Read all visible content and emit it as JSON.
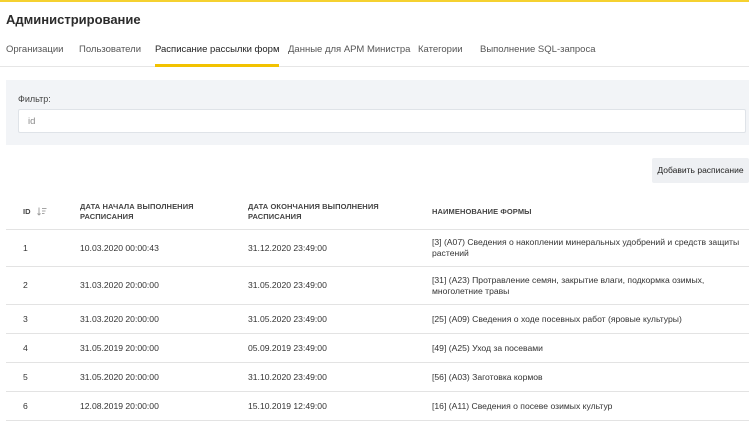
{
  "app": {
    "title": "Администрирование"
  },
  "tabs": [
    {
      "label": "Организации",
      "active": false
    },
    {
      "label": "Пользователи",
      "active": false
    },
    {
      "label": "Расписание рассылки форм",
      "active": true
    },
    {
      "label": "Данные для АРМ Министра",
      "active": false
    },
    {
      "label": "Категории",
      "active": false
    },
    {
      "label": "Выполнение SQL-запроса",
      "active": false
    }
  ],
  "filter": {
    "label": "Фильтр:",
    "placeholder": "id",
    "value": ""
  },
  "toolbar": {
    "add_label": "Добавить расписание"
  },
  "table": {
    "columns": [
      {
        "key": "id",
        "label": "ID",
        "sort_icon": "sort-icon"
      },
      {
        "key": "start",
        "label": "ДАТА НАЧАЛА ВЫПОЛНЕНИЯ РАСПИСАНИЯ"
      },
      {
        "key": "end",
        "label": "ДАТА ОКОНЧАНИЯ ВЫПОЛНЕНИЯ РАСПИСАНИЯ"
      },
      {
        "key": "name",
        "label": "НАИМЕНОВАНИЕ ФОРМЫ"
      }
    ],
    "rows": [
      {
        "id": "1",
        "start": "10.03.2020 00:00:43",
        "end": "31.12.2020 23:49:00",
        "name": "[3] (А07) Сведения о накоплении минеральных удобрений и средств защиты растений"
      },
      {
        "id": "2",
        "start": "31.03.2020 20:00:00",
        "end": "31.05.2020 23:49:00",
        "name": "[31] (А23) Протравление семян, закрытие влаги, подкормка озимых, многолетние травы"
      },
      {
        "id": "3",
        "start": "31.03.2020 20:00:00",
        "end": "31.05.2020 23:49:00",
        "name": "[25] (А09) Сведения о ходе посевных работ (яровые культуры)"
      },
      {
        "id": "4",
        "start": "31.05.2019 20:00:00",
        "end": "05.09.2019 23:49:00",
        "name": "[49] (А25) Уход за посевами"
      },
      {
        "id": "5",
        "start": "31.05.2020 20:00:00",
        "end": "31.10.2020 23:49:00",
        "name": "[56] (А03) Заготовка кормов"
      },
      {
        "id": "6",
        "start": "12.08.2019 20:00:00",
        "end": "15.10.2019 12:49:00",
        "name": "[16] (А11) Сведения о посеве озимых культур"
      }
    ]
  },
  "colors": {
    "accent": "#f2c200",
    "panel": "#f2f4f7",
    "border": "#e3e3e3"
  }
}
